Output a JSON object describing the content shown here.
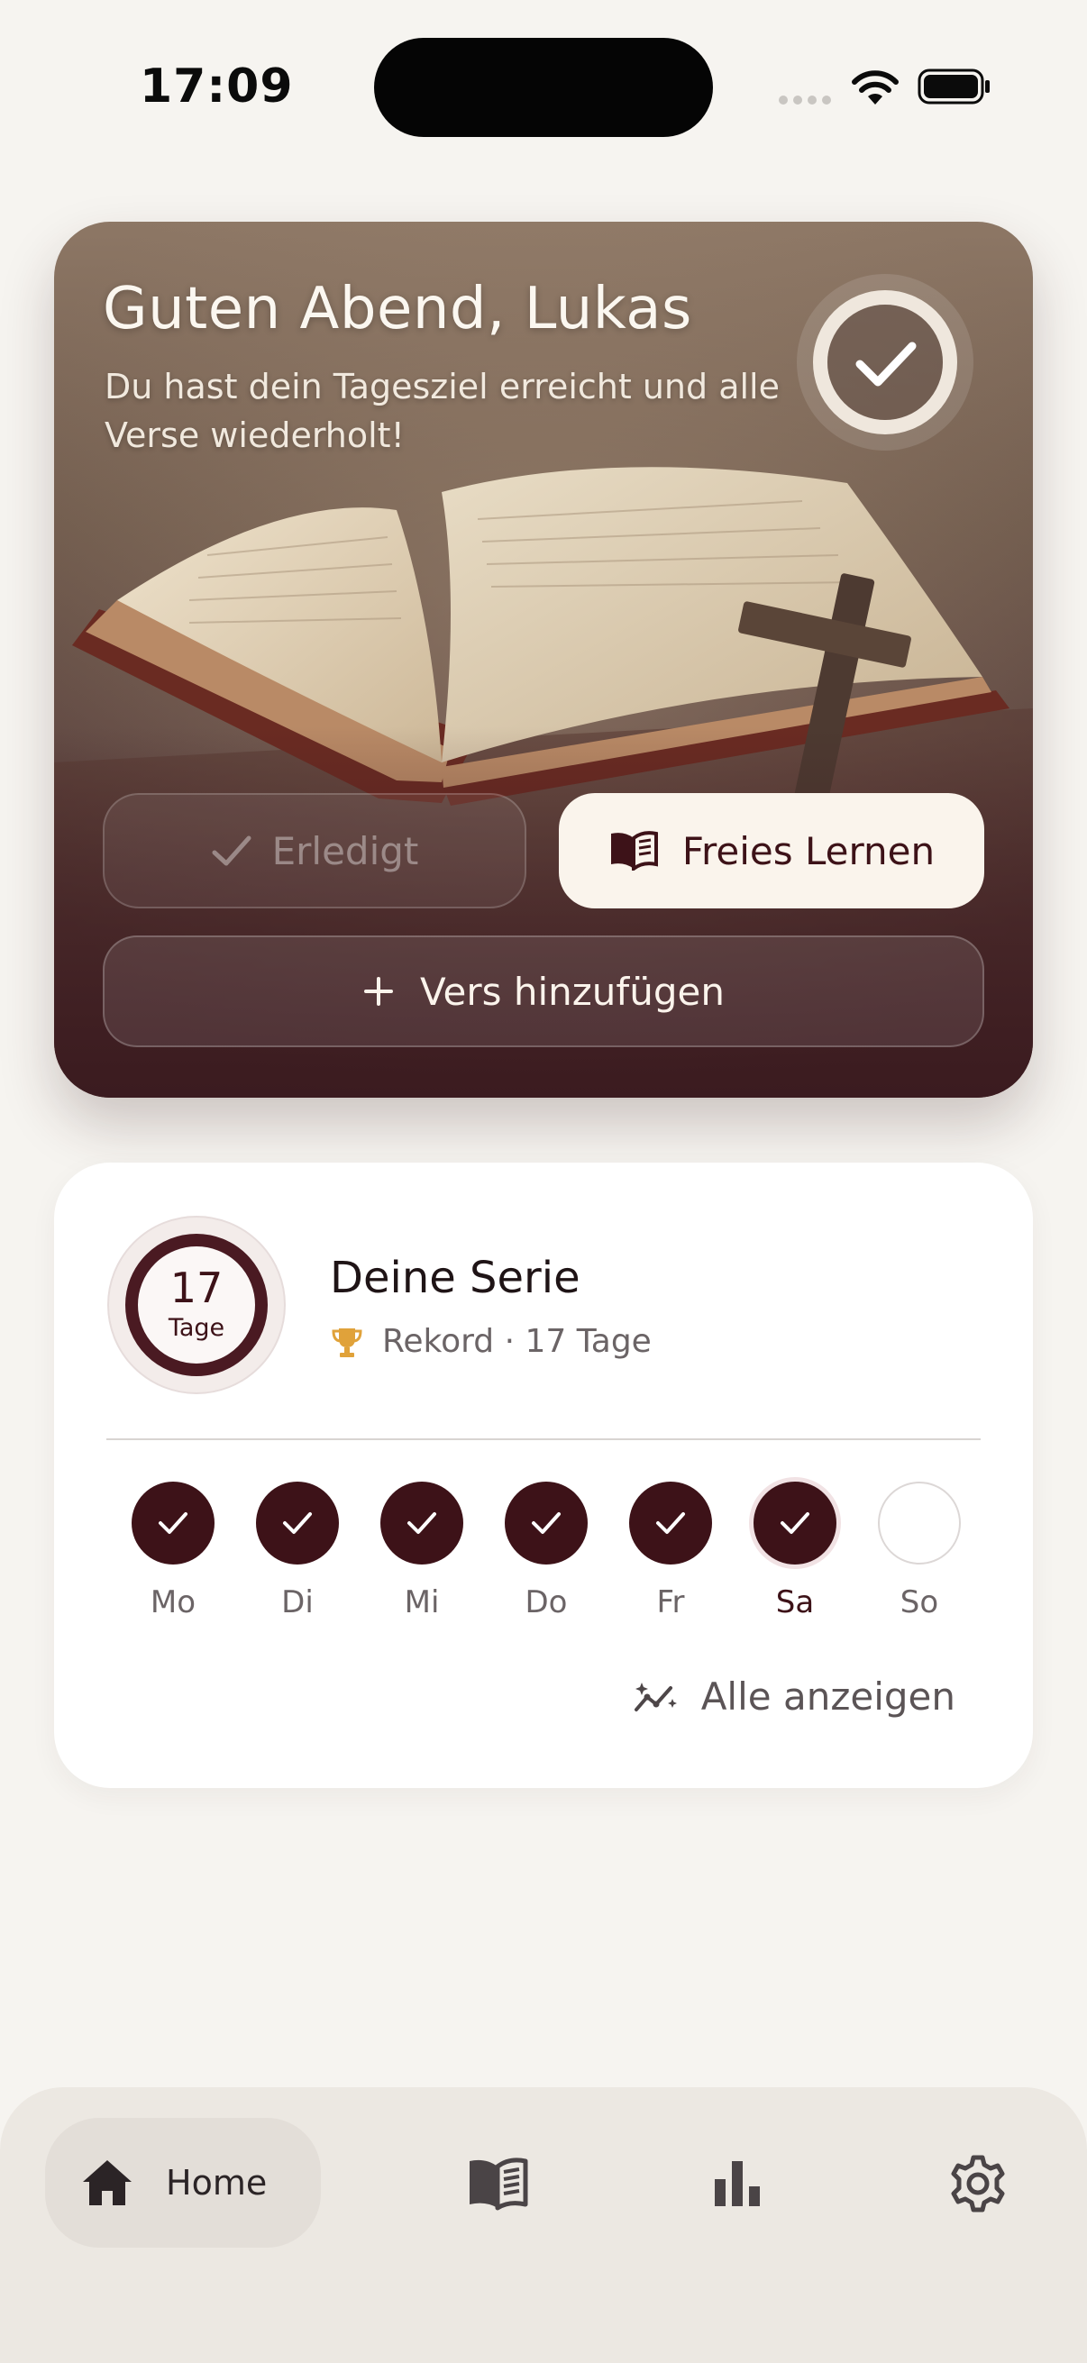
{
  "status_bar": {
    "time": "17:09"
  },
  "hero": {
    "greeting": "Guten Abend, Lukas",
    "subtitle": "Du hast dein Tagesziel erreicht und alle Verse wiederholt!",
    "buttons": {
      "done_label": "Erledigt",
      "free_learning_label": "Freies Lernen",
      "add_verse_label": "Vers hinzufügen"
    }
  },
  "streak": {
    "title": "Deine Serie",
    "count": "17",
    "unit": "Tage",
    "record": "Rekord · 17 Tage",
    "days": [
      {
        "label": "Mo",
        "done": true
      },
      {
        "label": "Di",
        "done": true
      },
      {
        "label": "Mi",
        "done": true
      },
      {
        "label": "Do",
        "done": true
      },
      {
        "label": "Fr",
        "done": true
      },
      {
        "label": "Sa",
        "done": true,
        "today": true
      },
      {
        "label": "So",
        "done": false
      }
    ],
    "show_all_label": "Alle anzeigen"
  },
  "tab_bar": {
    "home_label": "Home",
    "items": [
      "home-icon",
      "book-icon",
      "stats-icon",
      "settings-icon"
    ]
  },
  "colors": {
    "accent": "#3d1218",
    "background": "#f6f4f0",
    "trophy": "#e0a23a"
  }
}
